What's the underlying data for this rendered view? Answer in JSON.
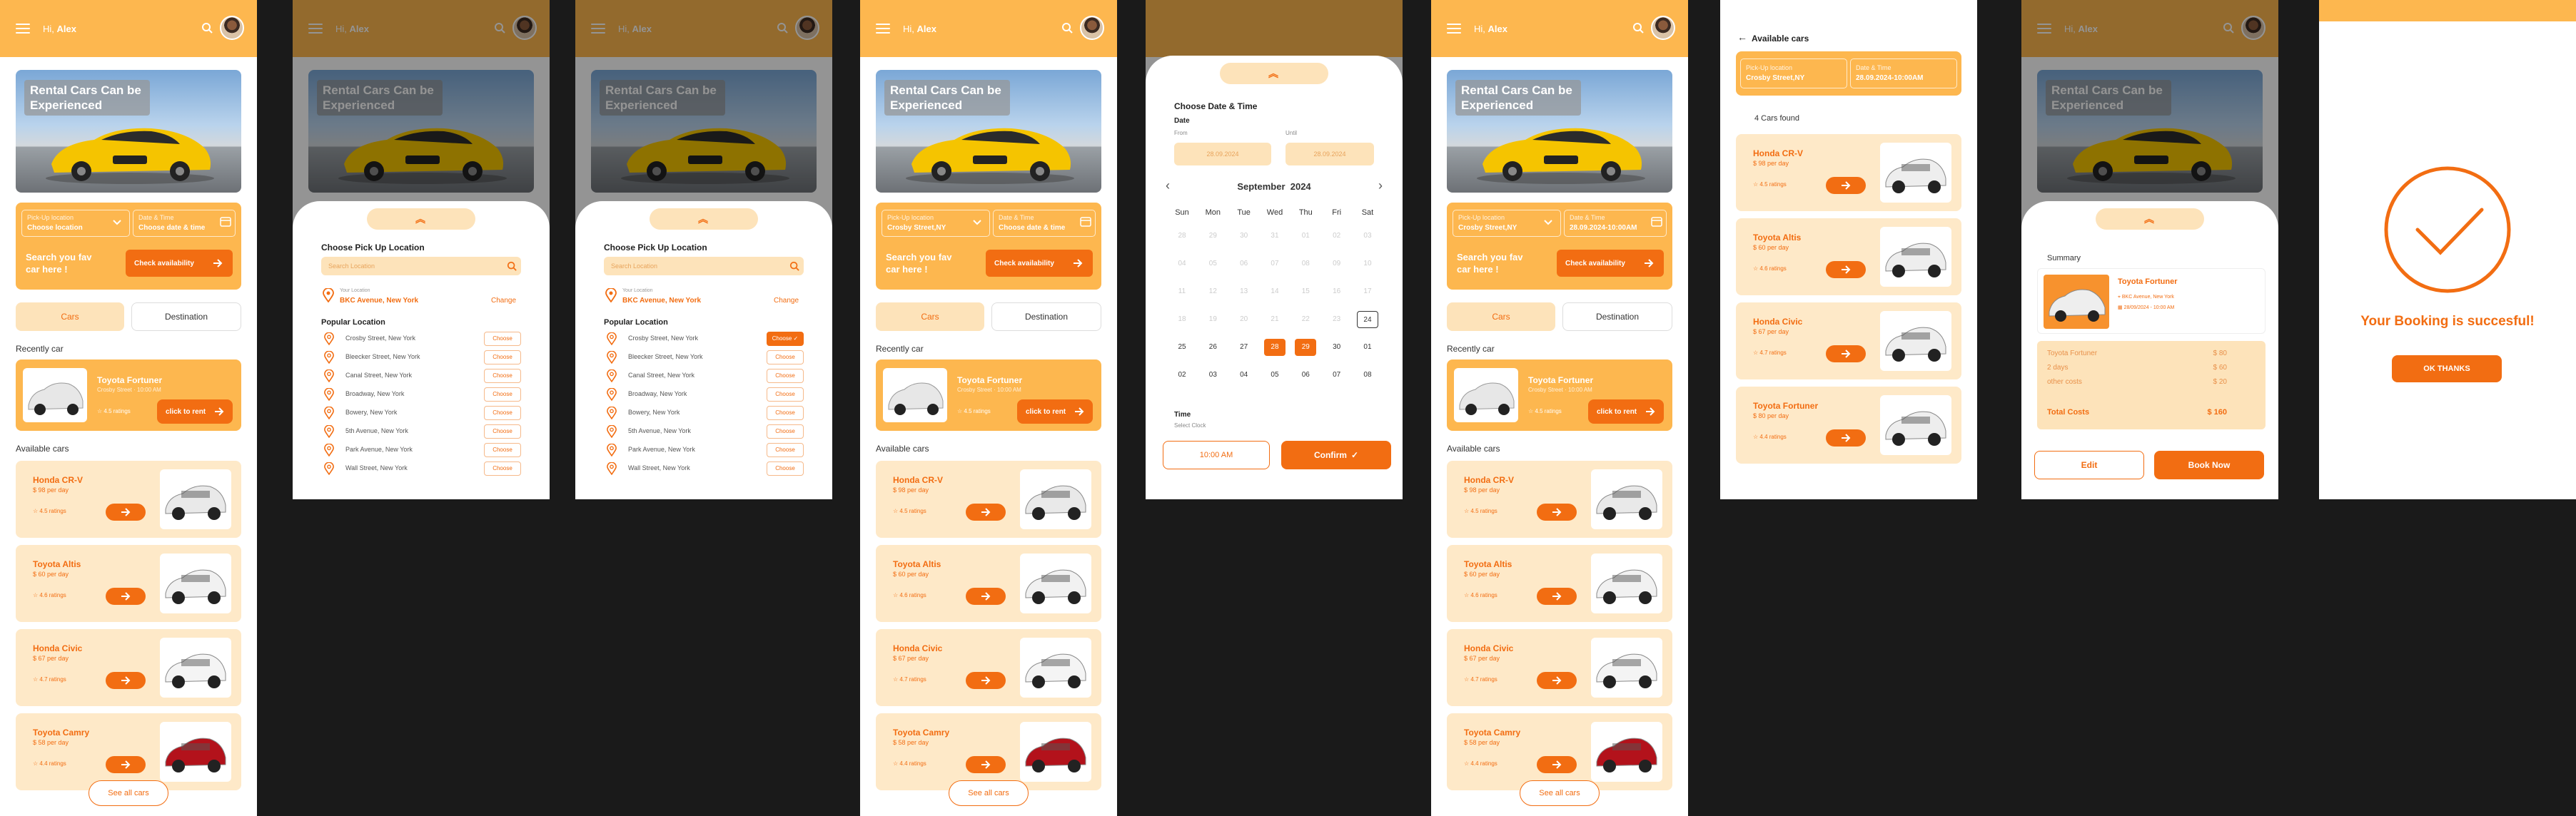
{
  "header": {
    "greeting_prefix": "Hi, ",
    "user_name": "Alex"
  },
  "hero": {
    "title": "Rental Cars Can be Experienced"
  },
  "booking": {
    "pickup_label": "Pick-Up location",
    "pickup_value": "Choose location",
    "pickup_value_selected": "Crosby Street,NY",
    "date_label": "Date & Time",
    "date_value": "Choose date & time",
    "date_value_selected": "28.09.2024-10:00AM",
    "search_text": "Search you fav car here !",
    "check_button": "Check availability"
  },
  "tabs": {
    "cars": "Cars",
    "destination": "Destination"
  },
  "recent": {
    "heading": "Recently car",
    "name": "Toyota Fortuner",
    "sub": "Crosby Street · 10:00 AM",
    "rating": "4.5 ratings",
    "rent_button": "click to rent"
  },
  "available": {
    "heading": "Available cars"
  },
  "cars": [
    {
      "name": "Honda CR-V",
      "price": "$ 98 per day",
      "rating": "4.5 ratings",
      "color": "#e9e9e9"
    },
    {
      "name": "Toyota Altis",
      "price": "$ 60 per day",
      "rating": "4.6 ratings",
      "color": "#f1f1f1"
    },
    {
      "name": "Honda Civic",
      "price": "$ 67 per day",
      "rating": "4.7 ratings",
      "color": "#f4f4f4"
    },
    {
      "name": "Toyota Camry",
      "price": "$ 58 per day",
      "rating": "4.4 ratings",
      "color": "#b3121b"
    }
  ],
  "see_all": "See all cars",
  "location_sheet": {
    "title": "Choose Pick Up Location",
    "search_placeholder": "Search Location",
    "current_label": "Your Location",
    "current_value": "BKC Avenue, New York",
    "change_button": "Change",
    "popular_heading": "Popular Location",
    "choose_label": "Choose",
    "locations": [
      "Crosby Street, New York",
      "Bleecker Street, New York",
      "Canal Street, New York",
      "Broadway, New York",
      "Bowery, New York",
      "5th Avenue, New York",
      "Park Avenue, New York",
      "Wall Street, New York"
    ]
  },
  "date_sheet": {
    "title": "Choose Date & Time",
    "date_heading": "Date",
    "from_label": "From",
    "until_label": "Until",
    "from_value": "28.09.2024",
    "until_value": "28.09.2024",
    "month": "September  2024",
    "weekdays": [
      "Sun",
      "Mon",
      "Tue",
      "Wed",
      "Thu",
      "Fri",
      "Sat"
    ],
    "weeks": [
      [
        "28",
        "29",
        "30",
        "31",
        "01",
        "02",
        "03"
      ],
      [
        "04",
        "05",
        "06",
        "07",
        "08",
        "09",
        "10"
      ],
      [
        "11",
        "12",
        "13",
        "14",
        "15",
        "16",
        "17"
      ],
      [
        "18",
        "19",
        "20",
        "21",
        "22",
        "23",
        "24"
      ],
      [
        "25",
        "26",
        "27",
        "28",
        "29",
        "30",
        "01"
      ],
      [
        "02",
        "03",
        "04",
        "05",
        "06",
        "07",
        "08"
      ]
    ],
    "time_heading": "Time",
    "time_sub": "Select Clock",
    "time_value": "10:00 AM",
    "confirm_button": "Confirm"
  },
  "results": {
    "back_title": "Available cars",
    "found": "4 Cars found",
    "cars": [
      {
        "name": "Honda CR-V",
        "price": "$ 98 per day",
        "rating": "4.5 ratings"
      },
      {
        "name": "Toyota Altis",
        "price": "$ 60 per day",
        "rating": "4.6 ratings"
      },
      {
        "name": "Honda Civic",
        "price": "$ 67 per day",
        "rating": "4.7 ratings"
      },
      {
        "name": "Toyota Fortuner",
        "price": "$ 80 per day",
        "rating": "4.4 ratings"
      }
    ]
  },
  "summary": {
    "heading": "Summary",
    "car_name": "Toyota Fortuner",
    "car_loc": "BKC Avenue, New York",
    "car_time": "28/09/2024 - 10:00 AM",
    "lines": [
      {
        "label": "Toyota Fortuner",
        "value": "$ 80"
      },
      {
        "label": "2 days",
        "value": "$ 60"
      },
      {
        "label": "other costs",
        "value": "$ 20"
      }
    ],
    "total_label": "Total Costs",
    "total_value": "$ 160",
    "edit_button": "Edit",
    "book_button": "Book Now"
  },
  "success": {
    "message": "Your Booking is succesful!",
    "ok_button": "OK THANKS"
  },
  "colors": {
    "primary": "#fdb74f",
    "accent": "#f26d12",
    "light": "#fee9c8"
  }
}
